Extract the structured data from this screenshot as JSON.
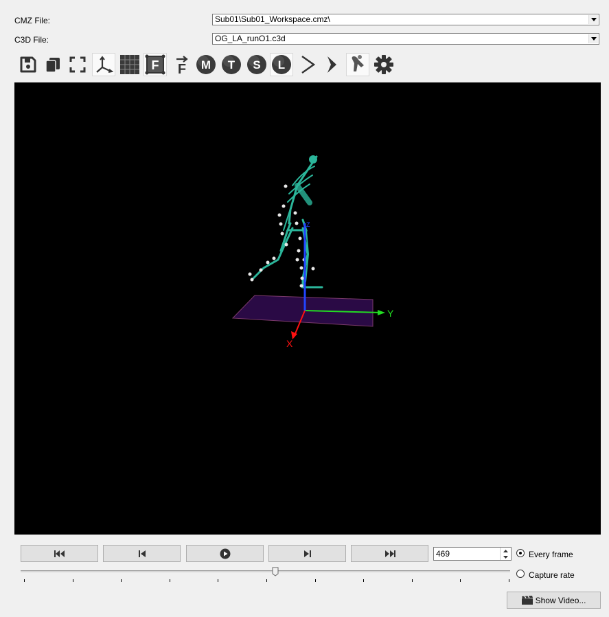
{
  "files": {
    "cmz_label": "CMZ File:",
    "cmz_value": "Sub01\\Sub01_Workspace.cmz\\",
    "c3d_label": "C3D File:",
    "c3d_value": "OG_LA_runO1.c3d"
  },
  "toolbar": {
    "items": [
      {
        "name": "save-icon"
      },
      {
        "name": "copy-icon"
      },
      {
        "name": "fullscreen-icon"
      },
      {
        "name": "axes-icon"
      },
      {
        "name": "grid-icon"
      },
      {
        "name": "force-platform-icon",
        "glyph": "F"
      },
      {
        "name": "force-vector-icon",
        "glyph": "F"
      },
      {
        "name": "model-m-icon",
        "glyph": "M"
      },
      {
        "name": "model-t-icon",
        "glyph": "T"
      },
      {
        "name": "model-s-icon",
        "glyph": "S"
      },
      {
        "name": "model-l-icon",
        "glyph": "L"
      },
      {
        "name": "chevron-icon"
      },
      {
        "name": "marker-icon"
      },
      {
        "name": "skeleton-icon"
      },
      {
        "name": "settings-gear-icon"
      }
    ]
  },
  "viewport": {
    "axis_labels": {
      "x": "X",
      "y": "Y",
      "z": "Z"
    },
    "colors": {
      "skeleton": "#2bb59a",
      "floor": "#2a0a45",
      "x_axis": "#ff1111",
      "y_axis": "#22dd22",
      "z_axis": "#2244ff"
    }
  },
  "playback": {
    "buttons": [
      "first-frame-icon",
      "previous-frame-icon",
      "play-icon",
      "next-frame-icon",
      "last-frame-icon"
    ],
    "frame": "469",
    "mode_every_frame": "Every frame",
    "mode_capture_rate": "Capture rate",
    "selected_mode": "every_frame",
    "slider_position_fraction": 0.52,
    "show_video_label": "Show Video..."
  }
}
